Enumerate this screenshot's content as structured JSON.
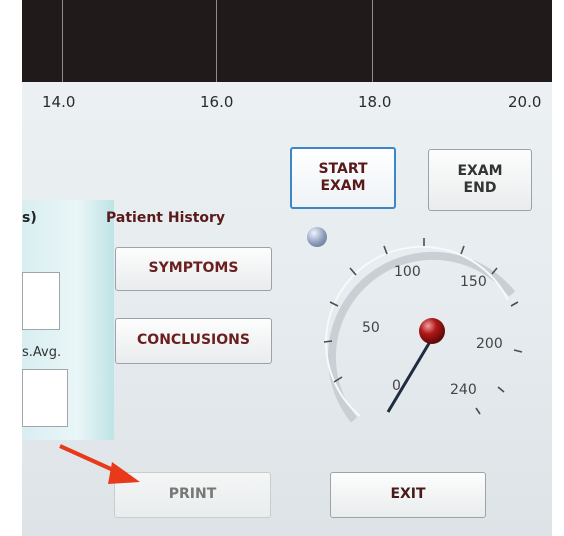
{
  "plot": {
    "x_ticks": [
      "14.0",
      "16.0",
      "18.0",
      "20.0"
    ]
  },
  "left_panel": {
    "top_label": "s)",
    "avg_label": "s.Avg."
  },
  "patient_history": {
    "label": "Patient History",
    "symptoms_label": "SYMPTOMS",
    "conclusions_label": "CONCLUSIONS"
  },
  "controls": {
    "start_line1": "START",
    "start_line2": "EXAM",
    "end_line1": "EXAM",
    "end_line2": "END",
    "print_label": "PRINT",
    "exit_label": "EXIT"
  },
  "gauge": {
    "labels": [
      "50",
      "100",
      "150",
      "200",
      "240",
      "0"
    ],
    "needle_value": 0
  },
  "colors": {
    "plot_bg": "#201a1b",
    "start_border": "#3d87c7",
    "label_text": "#6b1f1f",
    "needle_ball": "#b01818",
    "arrow": "#e83a1a"
  }
}
